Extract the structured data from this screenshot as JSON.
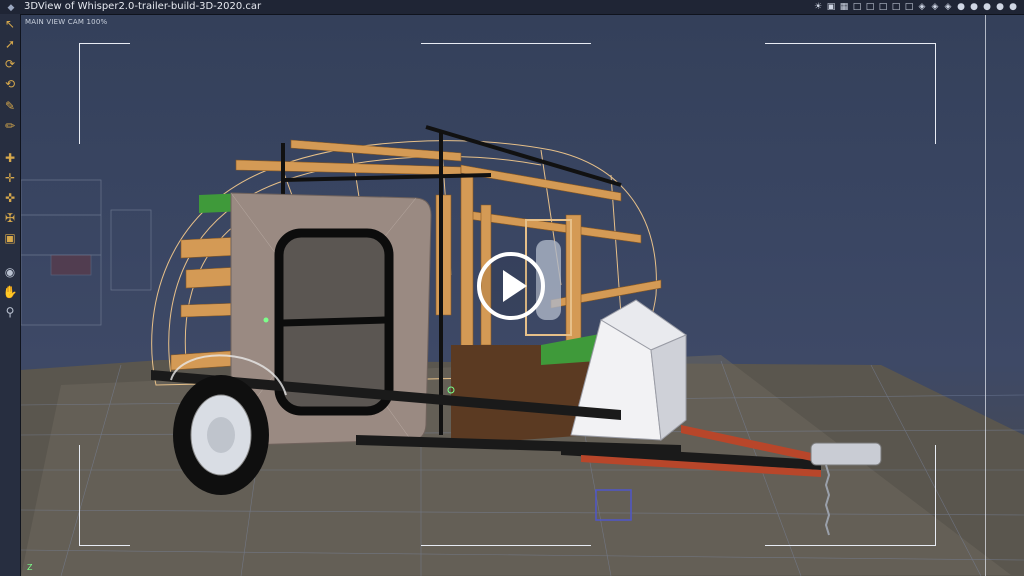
{
  "window": {
    "title": "3DView of Whisper2.0-trailer-build-3D-2020.car",
    "icon": "app-window-icon",
    "title_icons": [
      "light-icon",
      "render-icon",
      "grid-icon",
      "view-1-icon",
      "view-2-icon",
      "view-3-icon",
      "view-4-icon",
      "view-5-icon",
      "shade-1-icon",
      "shade-2-icon",
      "shade-3-icon",
      "sphere-1-icon",
      "sphere-2-icon",
      "sphere-3-icon",
      "sphere-4-icon",
      "sphere-5-icon"
    ]
  },
  "viewport": {
    "camera_label": "MAIN VIEW CAM 100%",
    "axis_label": "Z"
  },
  "toolbar": {
    "tools": [
      "select-arrow-icon",
      "move-arrow-icon",
      "rotate-icon",
      "rotate-2-icon",
      "pen-icon",
      "brush-icon",
      "transform-icon",
      "translate-icon",
      "scale-icon",
      "rotate-object-icon",
      "cube-icon",
      "camera-icon",
      "hand-pan-icon",
      "zoom-icon"
    ]
  },
  "overlay": {
    "play_button": "play-icon"
  },
  "colors": {
    "background": "#2f3a52",
    "wood": "#d49a55",
    "panel": "#9a8a82",
    "chassis": "#1a1a1a",
    "tongue": "#b8462a"
  }
}
